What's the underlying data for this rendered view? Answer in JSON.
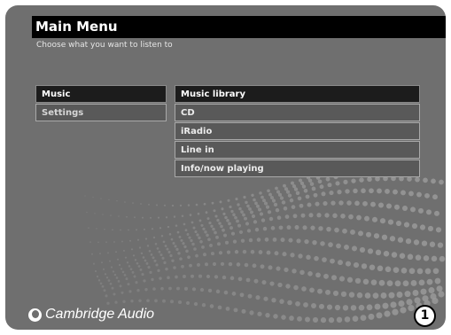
{
  "header": {
    "title": "Main Menu",
    "subtitle": "Choose what you want to listen to"
  },
  "left_menu": {
    "items": [
      {
        "label": "Music",
        "selected": true
      },
      {
        "label": "Settings",
        "selected": false
      }
    ]
  },
  "right_menu": {
    "items": [
      {
        "label": "Music library",
        "selected": true
      },
      {
        "label": "CD",
        "selected": false
      },
      {
        "label": "iRadio",
        "selected": false
      },
      {
        "label": "Line in",
        "selected": false
      },
      {
        "label": "Info/now playing",
        "selected": false
      }
    ]
  },
  "brand": {
    "logo_text": "Cambridge Audio",
    "logo_icon": "cambridge-audio-logo-icon"
  },
  "badge": {
    "number": "1"
  },
  "colors": {
    "screen_background": "#6f6f6f",
    "title_bar": "#000000",
    "selected_item": "#1c1c1c",
    "normal_item": "#595959"
  }
}
